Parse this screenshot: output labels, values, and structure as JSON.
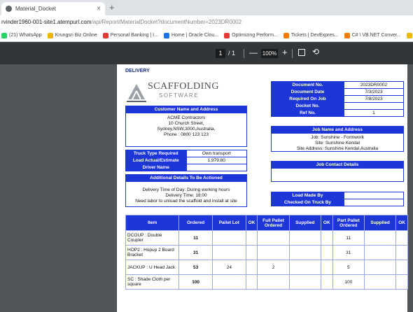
{
  "browser": {
    "tab_title": "Material_Docket",
    "tab_close": "×",
    "new_tab": "+",
    "url_main": "rvinder1960-001-site1.atempurl.com",
    "url_path": "/api/Report/MaterialDocket?documentNumber=2023DR0002",
    "bookmarks": [
      {
        "label": "(21) WhatsApp",
        "color": "#25d366"
      },
      {
        "label": "Krungsri Biz Online",
        "color": "#f2b600"
      },
      {
        "label": "Personal Banking | I...",
        "color": "#e53935"
      },
      {
        "label": "Home | Oracle Clou...",
        "color": "#1a73e8"
      },
      {
        "label": "Optimizing Perform...",
        "color": "#e53935"
      },
      {
        "label": "Tickets | DevExpres...",
        "color": "#f57c00"
      },
      {
        "label": "C# \\ VB.NET Conver...",
        "color": "#f57c00"
      },
      {
        "label": "How to hide",
        "color": "#f2b600"
      }
    ]
  },
  "pdf_toolbar": {
    "page_current": "1",
    "page_total": "/ 1",
    "zoom_out": "—",
    "zoom": "100%",
    "zoom_in": "+",
    "rotate": "⟲"
  },
  "doc": {
    "heading": "DELIVERY",
    "logo_top": "SCAFFOLDING",
    "logo_sub": "SOFTWARE",
    "customer_header": "Customer Name and Address",
    "customer_lines": [
      "ACME Contractors",
      "10 Church Street,",
      "Sydney,NSW,3000,Australia,",
      "Phone : 0800 123 123"
    ],
    "truck_rows": [
      {
        "k": "Truck Type Required",
        "v": "Own transport"
      },
      {
        "k": "Load Actual/Estimate",
        "v": "1,979.80"
      },
      {
        "k": "Driver Name",
        "v": ""
      }
    ],
    "additional_header": "Additional Details To Be Actioned",
    "additional_lines": [
      "Delivery Time of Day: During working hours",
      "Delivery Time: 18:00",
      "Need labor to unload the scaffold and install at site"
    ],
    "doc_rows": [
      {
        "k": "Document No.",
        "v": "2023DR0002"
      },
      {
        "k": "Document Date",
        "v": "7/3/2023"
      },
      {
        "k": "Required On Job",
        "v": "7/8/2023"
      },
      {
        "k": "Docket No.",
        "v": ""
      },
      {
        "k": "Ref No.",
        "v": "1"
      }
    ],
    "job_header": "Job Name and Address",
    "job_lines": [
      "Job: Sunshine - Formwork",
      "Site: Sunshine Kendal",
      "Site Address: Sunshine Kendal,Australia"
    ],
    "contact_header": "Job Contact Details",
    "load_rows": [
      {
        "k": "Load Made By",
        "v": ""
      },
      {
        "k": "Checked On Truck By",
        "v": ""
      }
    ],
    "columns": [
      "Item",
      "Ordered",
      "Pallet Lot",
      "OK",
      "Full Pallet Ordered",
      "Supplied",
      "OK",
      "Part Pallet Ordered",
      "Supplied",
      "OK"
    ],
    "rows": [
      [
        "DCOUP : Double Coupler",
        "11",
        "",
        "",
        "",
        "",
        "",
        "11",
        "",
        ""
      ],
      [
        "HOP2 : Hopup 2 Board Bracket",
        "31",
        "",
        "",
        "",
        "",
        "",
        "31",
        "",
        ""
      ],
      [
        "JACKUP : U Head Jack",
        "53",
        "24",
        "",
        "2",
        "",
        "",
        "5",
        "",
        ""
      ],
      [
        "SC : Shade Cloth per square",
        "100",
        "",
        "",
        "",
        "",
        "",
        "100",
        "",
        ""
      ]
    ]
  }
}
